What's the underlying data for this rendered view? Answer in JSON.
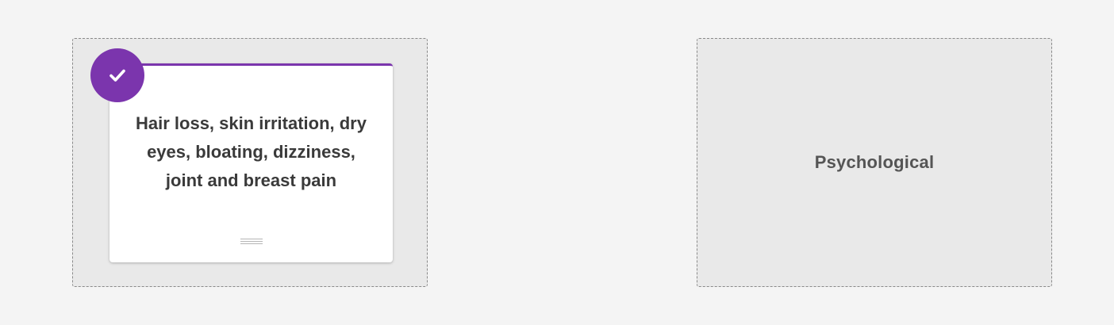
{
  "colors": {
    "accent": "#7b35ad",
    "zone_background": "#e9e9e9",
    "page_background": "#f4f4f4"
  },
  "left_zone": {
    "card": {
      "text": "Hair loss, skin irritation, dry eyes, bloating, dizziness, joint and breast pain",
      "status_icon": "check-icon",
      "handle_icon": "drag-handle-icon"
    }
  },
  "right_zone": {
    "label": "Psychological"
  }
}
